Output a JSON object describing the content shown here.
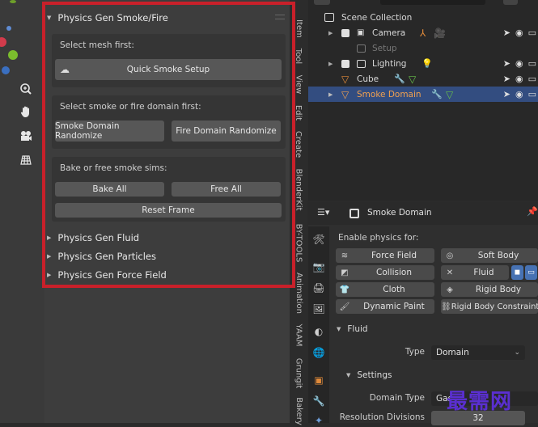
{
  "viewport_tools": [
    {
      "name": "zoom-icon",
      "glyph": "⊕"
    },
    {
      "name": "hand-icon",
      "glyph": "✋"
    },
    {
      "name": "camera-icon",
      "glyph": "🎥"
    },
    {
      "name": "grid-icon",
      "glyph": "▦"
    }
  ],
  "npanel": {
    "smoke_panel_title": "Physics Gen Smoke/Fire",
    "box1_label": "Select mesh first:",
    "quick_smoke": "Quick Smoke Setup",
    "box2_label": "Select smoke or fire domain first:",
    "smoke_randomize": "Smoke Domain Randomize",
    "fire_randomize": "Fire Domain Randomize",
    "box3_label": "Bake or free smoke sims:",
    "bake_all": "Bake All",
    "free_all": "Free All",
    "reset_frame": "Reset Frame",
    "collapsed_panels": [
      "Physics Gen Fluid",
      "Physics Gen Particles",
      "Physics Gen Force Field"
    ]
  },
  "tabs": [
    "Item",
    "Tool",
    "View",
    "Edit",
    "Create",
    "BlenderKit",
    "BY-TOOLS",
    "Animation",
    "YAAM",
    "Grungit",
    "Bakery"
  ],
  "outliner": {
    "root": "Scene Collection",
    "items": [
      {
        "label": "Camera",
        "kind": "camera"
      },
      {
        "label": "Setup",
        "kind": "collection"
      },
      {
        "label": "Lighting",
        "kind": "collection"
      },
      {
        "label": "Cube",
        "kind": "mesh"
      },
      {
        "label": "Smoke Domain",
        "kind": "mesh"
      }
    ]
  },
  "properties": {
    "object_name": "Smoke Domain",
    "enable_label": "Enable physics for:",
    "physics_buttons": [
      {
        "label": "Force Field",
        "icon": "≋"
      },
      {
        "label": "Soft Body",
        "icon": "◎"
      },
      {
        "label": "Collision",
        "icon": "◩"
      },
      {
        "label": "Fluid",
        "icon": "✕"
      },
      {
        "label": "Cloth",
        "icon": "👕"
      },
      {
        "label": "Rigid Body",
        "icon": "◈"
      },
      {
        "label": "Dynamic Paint",
        "icon": "🖌"
      },
      {
        "label": "Rigid Body Constraint",
        "icon": "⛓"
      }
    ],
    "fluid_section": "Fluid",
    "type_label": "Type",
    "type_value": "Domain",
    "settings_section": "Settings",
    "domain_type_label": "Domain Type",
    "domain_type_value": "Gas",
    "resolution_label": "Resolution Divisions",
    "resolution_value": "32"
  },
  "watermark": "最需网",
  "colors": {
    "highlight": "#c9202a",
    "selected_row": "#334d80",
    "selected_text": "#f0a050",
    "watermark": "#5a2fd0"
  }
}
